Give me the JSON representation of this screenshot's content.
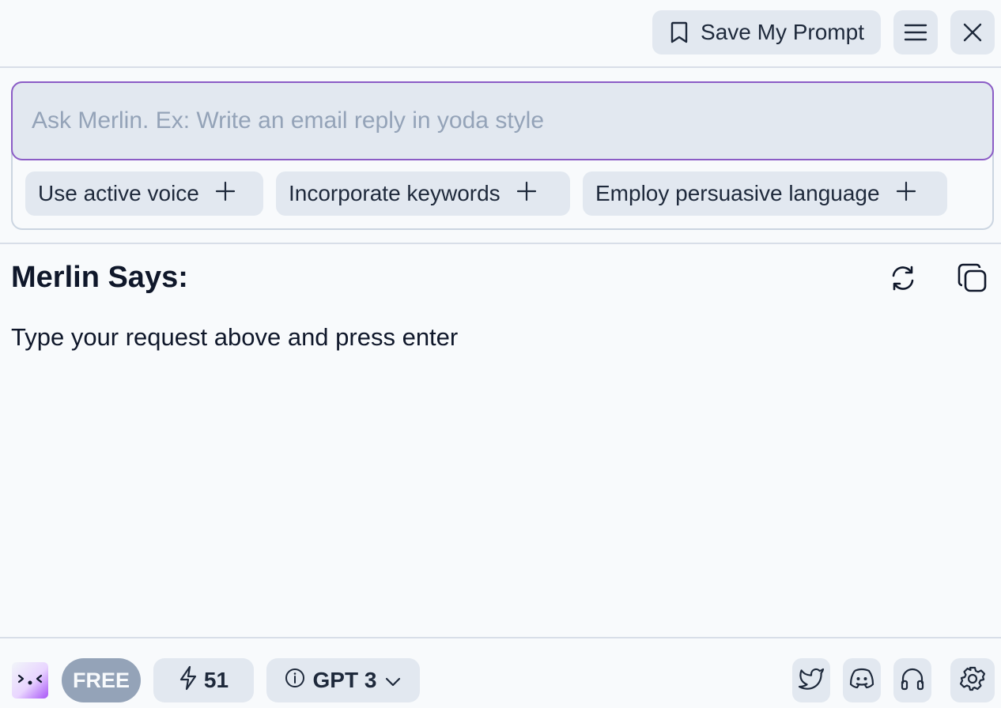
{
  "header": {
    "save_label": "Save My Prompt",
    "icons": [
      "bookmark-icon",
      "menu-icon",
      "close-icon"
    ]
  },
  "prompt": {
    "placeholder": "Ask Merlin. Ex: Write an email reply in yoda style",
    "value": "",
    "suggestions": [
      {
        "label": "Use active voice",
        "icon": "plus-icon"
      },
      {
        "label": "Incorporate keywords",
        "icon": "plus-icon"
      },
      {
        "label": "Employ persuasive language",
        "icon": "plus-icon"
      }
    ]
  },
  "response": {
    "title": "Merlin Says:",
    "text": "Type your request above and press enter",
    "icons": [
      "refresh-icon",
      "copy-icon"
    ]
  },
  "footer": {
    "logo_text": ">.<",
    "plan_badge": "FREE",
    "credits": "51",
    "model": "GPT 3",
    "icons": [
      "bolt-icon",
      "info-icon",
      "chevron-down-icon",
      "twitter-icon",
      "discord-icon",
      "headphones-icon",
      "gear-icon"
    ]
  },
  "colors": {
    "background": "#f8fafc",
    "accent_border": "#8b5cc6",
    "chip_bg": "#e2e8f0",
    "badge_bg": "#94a3b8"
  }
}
